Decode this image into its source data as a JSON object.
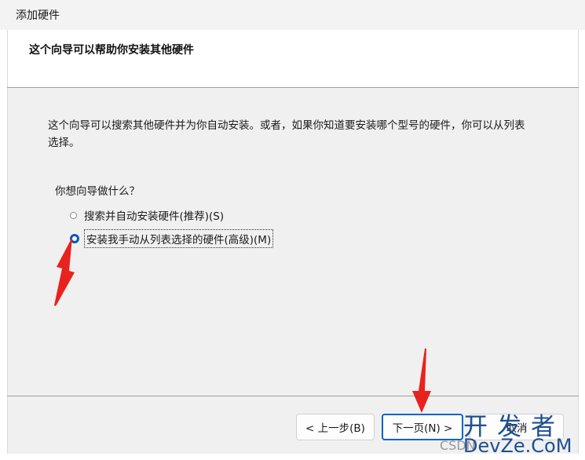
{
  "window": {
    "title": "添加硬件"
  },
  "header": {
    "title": "这个向导可以帮助你安装其他硬件"
  },
  "body": {
    "description": "这个向导可以搜索其他硬件并为你自动安装。或者，如果你知道要安装哪个型号的硬件，你可以从列表选择。",
    "question": "你想向导做什么？",
    "options": [
      {
        "label": "搜索并自动安装硬件(推荐)(S)",
        "selected": false
      },
      {
        "label": "安装我手动从列表选择的硬件(高级)(M)",
        "selected": true
      }
    ]
  },
  "footer": {
    "back_label": "< 上一步(B)",
    "next_label": "下一页(N) >",
    "cancel_label": "取消"
  },
  "watermark": {
    "line1": "开发者",
    "line2": "DevZe.CoM",
    "small": "CSDN"
  },
  "colors": {
    "accent": "#0a57c4",
    "annotation_arrow": "#e8231d"
  }
}
